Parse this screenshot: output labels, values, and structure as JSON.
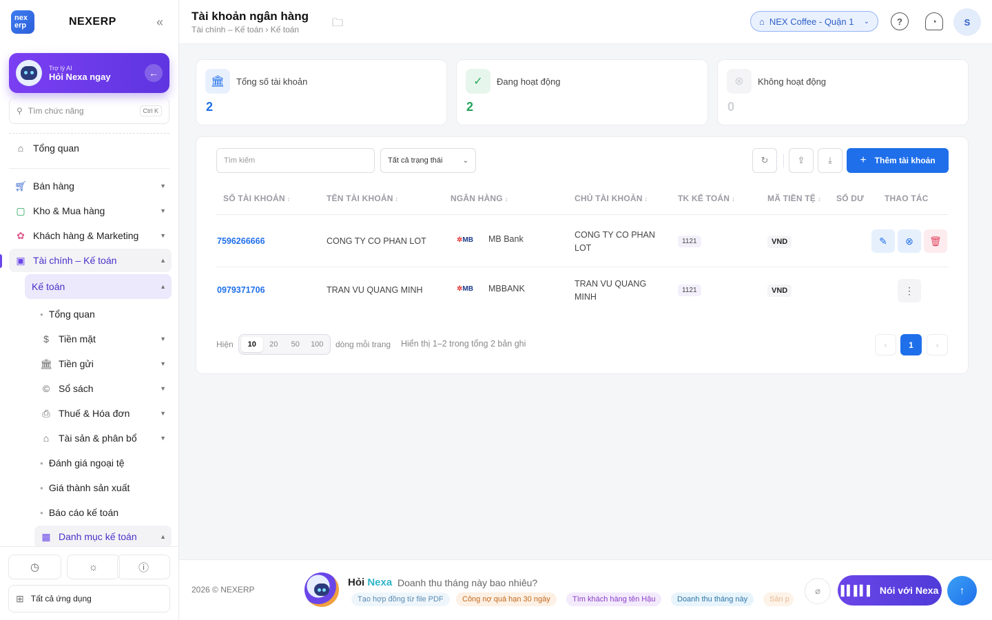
{
  "app": {
    "name": "NEXERP",
    "logo_line1": "nex",
    "logo_line2": "erp"
  },
  "sidebar": {
    "ai_small": "Trợ lý AI",
    "ai_big": "Hỏi Nexa ngay",
    "search_placeholder": "Tìm chức năng",
    "search_shortcut": "Ctrl K",
    "overview": "Tổng quan",
    "groups": [
      {
        "label": "Bán hàng"
      },
      {
        "label": "Kho & Mua hàng"
      },
      {
        "label": "Khách hàng & Marketing"
      },
      {
        "label": "Tài chính – Kế toán"
      }
    ],
    "sub_active": "Kế toán",
    "sub_items": [
      {
        "label": "Tổng quan"
      },
      {
        "label": "Tiền mặt"
      },
      {
        "label": "Tiền gửi"
      },
      {
        "label": "Sổ sách"
      },
      {
        "label": "Thuế & Hóa đơn"
      },
      {
        "label": "Tài sản & phân bổ"
      },
      {
        "label": "Đánh giá ngoại tệ"
      },
      {
        "label": "Giá thành sản xuất"
      },
      {
        "label": "Báo cáo kế toán"
      },
      {
        "label": "Danh mục kế toán"
      }
    ],
    "all_apps": "Tất cả ứng dụng"
  },
  "header": {
    "title": "Tài khoản ngân hàng",
    "breadcrumb": "Tài chính – Kế toán › Kế toán",
    "store": "NEX Coffee - Quận 1",
    "avatar": "S"
  },
  "stats": [
    {
      "label": "Tổng số tài khoản",
      "value": "2",
      "color": "#1f6fea"
    },
    {
      "label": "Đang hoạt động",
      "value": "2",
      "color": "#22a55a"
    },
    {
      "label": "Không hoạt động",
      "value": "0",
      "color": "#cfd1d6"
    }
  ],
  "toolbar": {
    "search_placeholder": "Tìm kiếm",
    "status_filter": "Tất cả trạng thái",
    "add_label": "Thêm tài khoản"
  },
  "table": {
    "columns": [
      "SỐ TÀI KHOẢN",
      "TÊN TÀI KHOẢN",
      "NGÂN HÀNG",
      "CHỦ TÀI KHOẢN",
      "TK KẾ TOÁN",
      "MÃ TIỀN TỆ",
      "SỐ DƯ",
      "THAO TÁC"
    ],
    "rows": [
      {
        "account_no": "7596266666",
        "account_name": "CONG TY CO PHAN LOT",
        "bank_logo": "MB",
        "bank": "MB Bank",
        "owner_1": "CONG TY CO PHAN",
        "owner_2": "LOT",
        "gl": "1121",
        "currency": "VND"
      },
      {
        "account_no": "0979371706",
        "account_name": "TRAN VU QUANG MINH",
        "bank_logo": "MB",
        "bank": "MBBANK",
        "owner_1": "TRAN VU QUANG",
        "owner_2": "MINH",
        "gl": "1121",
        "currency": "VND"
      }
    ]
  },
  "pagination": {
    "show_label": "Hiện",
    "sizes": [
      "10",
      "20",
      "50",
      "100"
    ],
    "per_page_label": "dòng mỗi trang",
    "summary": "Hiển thị 1–2 trong tổng 2 bản ghi",
    "current": "1"
  },
  "footer": {
    "copyright": "2026 © NEXERP",
    "ask_prefix": "Hỏi",
    "ask_brand": "Nexa",
    "question": "Doanh thu tháng này bao nhiêu?",
    "chips": [
      "Tạo hợp đồng từ file PDF",
      "Công nợ quá hạn 30 ngày",
      "Tìm khách hàng tên Hậu",
      "Doanh thu tháng này",
      "Sản p"
    ],
    "voice_label": "Nói với Nexa"
  }
}
